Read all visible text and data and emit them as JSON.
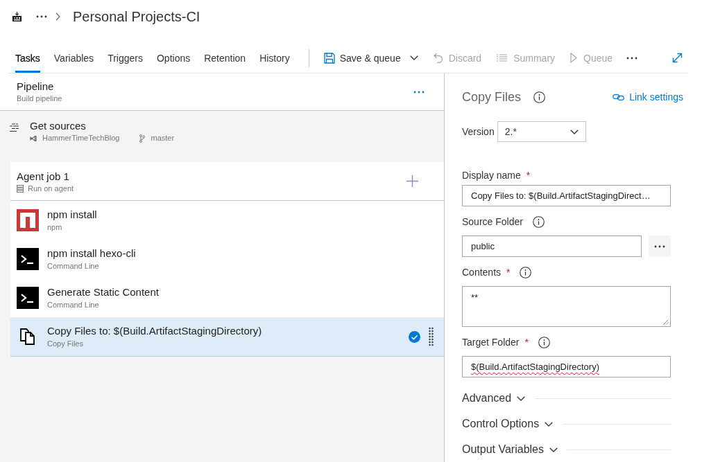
{
  "header": {
    "title": "Personal Projects-CI"
  },
  "tabs": [
    {
      "label": "Tasks",
      "selected": true
    },
    {
      "label": "Variables",
      "selected": false
    },
    {
      "label": "Triggers",
      "selected": false
    },
    {
      "label": "Options",
      "selected": false
    },
    {
      "label": "Retention",
      "selected": false
    },
    {
      "label": "History",
      "selected": false
    }
  ],
  "toolbar": [
    {
      "kind": "save",
      "label": "Save & queue",
      "disabled": false
    },
    {
      "kind": "discard",
      "label": "Discard",
      "disabled": true
    },
    {
      "kind": "summary",
      "label": "Summary",
      "disabled": true
    },
    {
      "kind": "queue",
      "label": "Queue",
      "disabled": true
    }
  ],
  "pipeline": {
    "title": "Pipeline",
    "subtitle": "Build pipeline"
  },
  "get_sources": {
    "title": "Get sources",
    "repository": "HammerTimeTechBlog",
    "branch": "master"
  },
  "agent_job": {
    "title": "Agent job 1",
    "subtitle": "Run on agent"
  },
  "tasks": [
    {
      "kind": "npm",
      "title": "npm install",
      "subtitle": "npm",
      "selected": false
    },
    {
      "kind": "command",
      "title": "npm install hexo-cli",
      "subtitle": "Command Line",
      "selected": false
    },
    {
      "kind": "command",
      "title": "Generate Static Content",
      "subtitle": "Command Line",
      "selected": false
    },
    {
      "kind": "copy",
      "title": "Copy Files to: $(Build.ArtifactStagingDirectory)",
      "subtitle": "Copy Files",
      "selected": true
    }
  ],
  "details": {
    "title": "Copy Files",
    "link": "Link settings",
    "version": {
      "label": "Version",
      "value": "2.*"
    },
    "fields": [
      {
        "kind": "text",
        "label": "Display name",
        "required_mark": "*",
        "info": false,
        "value": "Copy Files to: $(Build.ArtifactStagingDirect…",
        "misspelled": false
      },
      {
        "kind": "browse",
        "label": "Source Folder",
        "info": true,
        "value": "public",
        "misspelled": false
      },
      {
        "kind": "multiline",
        "label": "Contents",
        "required_mark": "*",
        "info": true,
        "value": "**",
        "misspelled": false
      },
      {
        "kind": "text",
        "label": "Target Folder",
        "required_mark": "*",
        "info": true,
        "value": "$(Build.ArtifactStagingDirectory)",
        "misspelled": true
      }
    ],
    "sections": [
      {
        "label": "Advanced",
        "expanded": false
      },
      {
        "label": "Control Options",
        "expanded": false
      },
      {
        "label": "Output Variables",
        "expanded": false
      }
    ]
  }
}
